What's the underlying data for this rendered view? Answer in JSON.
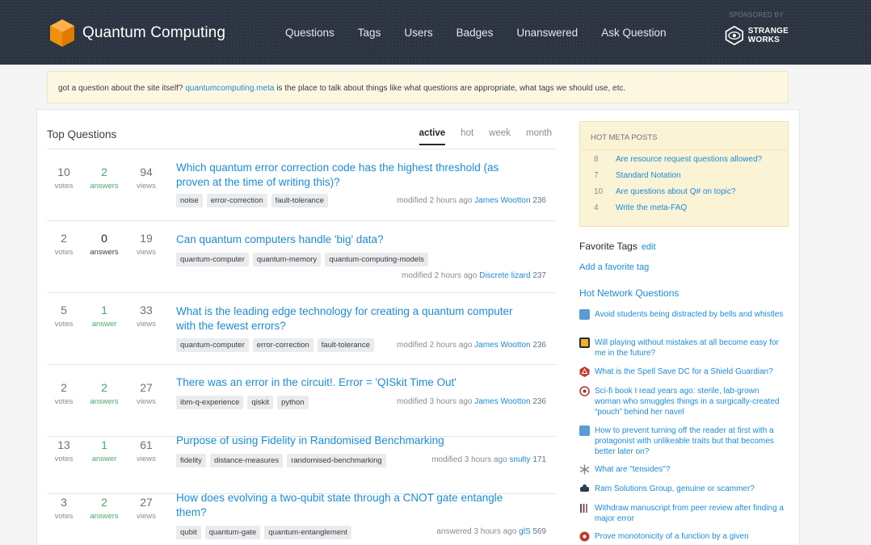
{
  "site": {
    "name": "Quantum Computing"
  },
  "nav": [
    "Questions",
    "Tags",
    "Users",
    "Badges",
    "Unanswered",
    "Ask Question"
  ],
  "sponsor": {
    "label": "SPONSORED BY",
    "line1": "STRANGE",
    "line2": "WORKS"
  },
  "notice": {
    "prefix": "got a question about the site itself? ",
    "link": "quantumcomputing.meta",
    "suffix": " is the place to talk about things like what questions are appropriate, what tags we should use, etc."
  },
  "top_questions": {
    "title": "Top Questions",
    "tabs": [
      "active",
      "hot",
      "week",
      "month"
    ],
    "active_tab": "active"
  },
  "questions": [
    {
      "votes": "10",
      "votes_label": "votes",
      "answers": "2",
      "answers_label": "answers",
      "views": "94",
      "views_label": "views",
      "title": "Which quantum error correction code has the highest threshold (as proven at the time of writing this)?",
      "tags": [
        "noise",
        "error-correction",
        "fault-tolerance"
      ],
      "action": "modified 2 hours ago",
      "user": "James Wootton",
      "rep": "236"
    },
    {
      "votes": "2",
      "votes_label": "votes",
      "answers": "0",
      "answers_label": "answers",
      "views": "19",
      "views_label": "views",
      "title": "Can quantum computers handle 'big' data?",
      "tags": [
        "quantum-computer",
        "quantum-memory",
        "quantum-computing-models"
      ],
      "action": "modified 2 hours ago",
      "user": "Discrete lizard",
      "rep": "237"
    },
    {
      "votes": "5",
      "votes_label": "votes",
      "answers": "1",
      "answers_label": "answer",
      "views": "33",
      "views_label": "views",
      "title": "What is the leading edge technology for creating a quantum computer with the fewest errors?",
      "tags": [
        "quantum-computer",
        "error-correction",
        "fault-tolerance"
      ],
      "action": "modified 2 hours ago",
      "user": "James Wootton",
      "rep": "236"
    },
    {
      "votes": "2",
      "votes_label": "votes",
      "answers": "2",
      "answers_label": "answers",
      "views": "27",
      "views_label": "views",
      "title": "There was an error in the circuit!. Error = 'QISkit Time Out'",
      "tags": [
        "ibm-q-experience",
        "qiskit",
        "python"
      ],
      "action": "modified 3 hours ago",
      "user": "James Wootton",
      "rep": "236"
    },
    {
      "votes": "13",
      "votes_label": "votes",
      "answers": "1",
      "answers_label": "answer",
      "views": "61",
      "views_label": "views",
      "title": "Purpose of using Fidelity in Randomised Benchmarking",
      "tags": [
        "fidelity",
        "distance-measures",
        "randomised-benchmarking"
      ],
      "action": "modified 3 hours ago",
      "user": "snulty",
      "rep": "171"
    },
    {
      "votes": "3",
      "votes_label": "votes",
      "answers": "2",
      "answers_label": "answers",
      "views": "27",
      "views_label": "views",
      "title": "How does evolving a two-qubit state through a CNOT gate entangle them?",
      "tags": [
        "qubit",
        "quantum-gate",
        "quantum-entanglement"
      ],
      "action": "answered 3 hours ago",
      "user": "glS",
      "rep": "569"
    }
  ],
  "meta_posts": {
    "title": "HOT META POSTS",
    "items": [
      {
        "count": "8",
        "title": "Are resource request questions allowed?"
      },
      {
        "count": "7",
        "title": "Standard Notation"
      },
      {
        "count": "10",
        "title": "Are questions about Q# on topic?"
      },
      {
        "count": "4",
        "title": "Write the meta-FAQ"
      }
    ]
  },
  "favorite_tags": {
    "title": "Favorite Tags",
    "edit": "edit",
    "add": "Add a favorite tag"
  },
  "hot_network": {
    "title": "Hot Network Questions",
    "items": [
      {
        "icon": "community-building-icon",
        "color": "#5b9bd5",
        "title": "Avoid students being distracted by bells and whistles"
      },
      {
        "icon": "worldbuilding-icon",
        "color": "#f0b323",
        "title": "Will playing without mistakes at all become easy for me in the future?"
      },
      {
        "icon": "rpg-icon",
        "color": "#c0392b",
        "title": "What is the Spell Save DC for a Shield Guardian?"
      },
      {
        "icon": "scifi-icon",
        "color": "#b03030",
        "title": "Sci-fi book I read years ago: sterile, lab-grown woman who smuggles things in a surgically-created “pouch” behind her navel"
      },
      {
        "icon": "writing-icon",
        "color": "#5b9bd5",
        "title": "How to prevent turning off the reader at first with a protagonist with unlikeable traits but that becomes better later on?"
      },
      {
        "icon": "chemistry-icon",
        "color": "#7a8590",
        "title": "What are \"tensides\"?"
      },
      {
        "icon": "money-icon",
        "color": "#2c3e50",
        "title": "Ram Solutions Group, genuine or scammer?"
      },
      {
        "icon": "academia-icon",
        "color": "#3b5b8a",
        "title": "Withdraw manuscript from peer review after finding a major error"
      },
      {
        "icon": "math-icon",
        "color": "#c0392b",
        "title": "Prove monotonicity of a function by a given"
      }
    ]
  }
}
